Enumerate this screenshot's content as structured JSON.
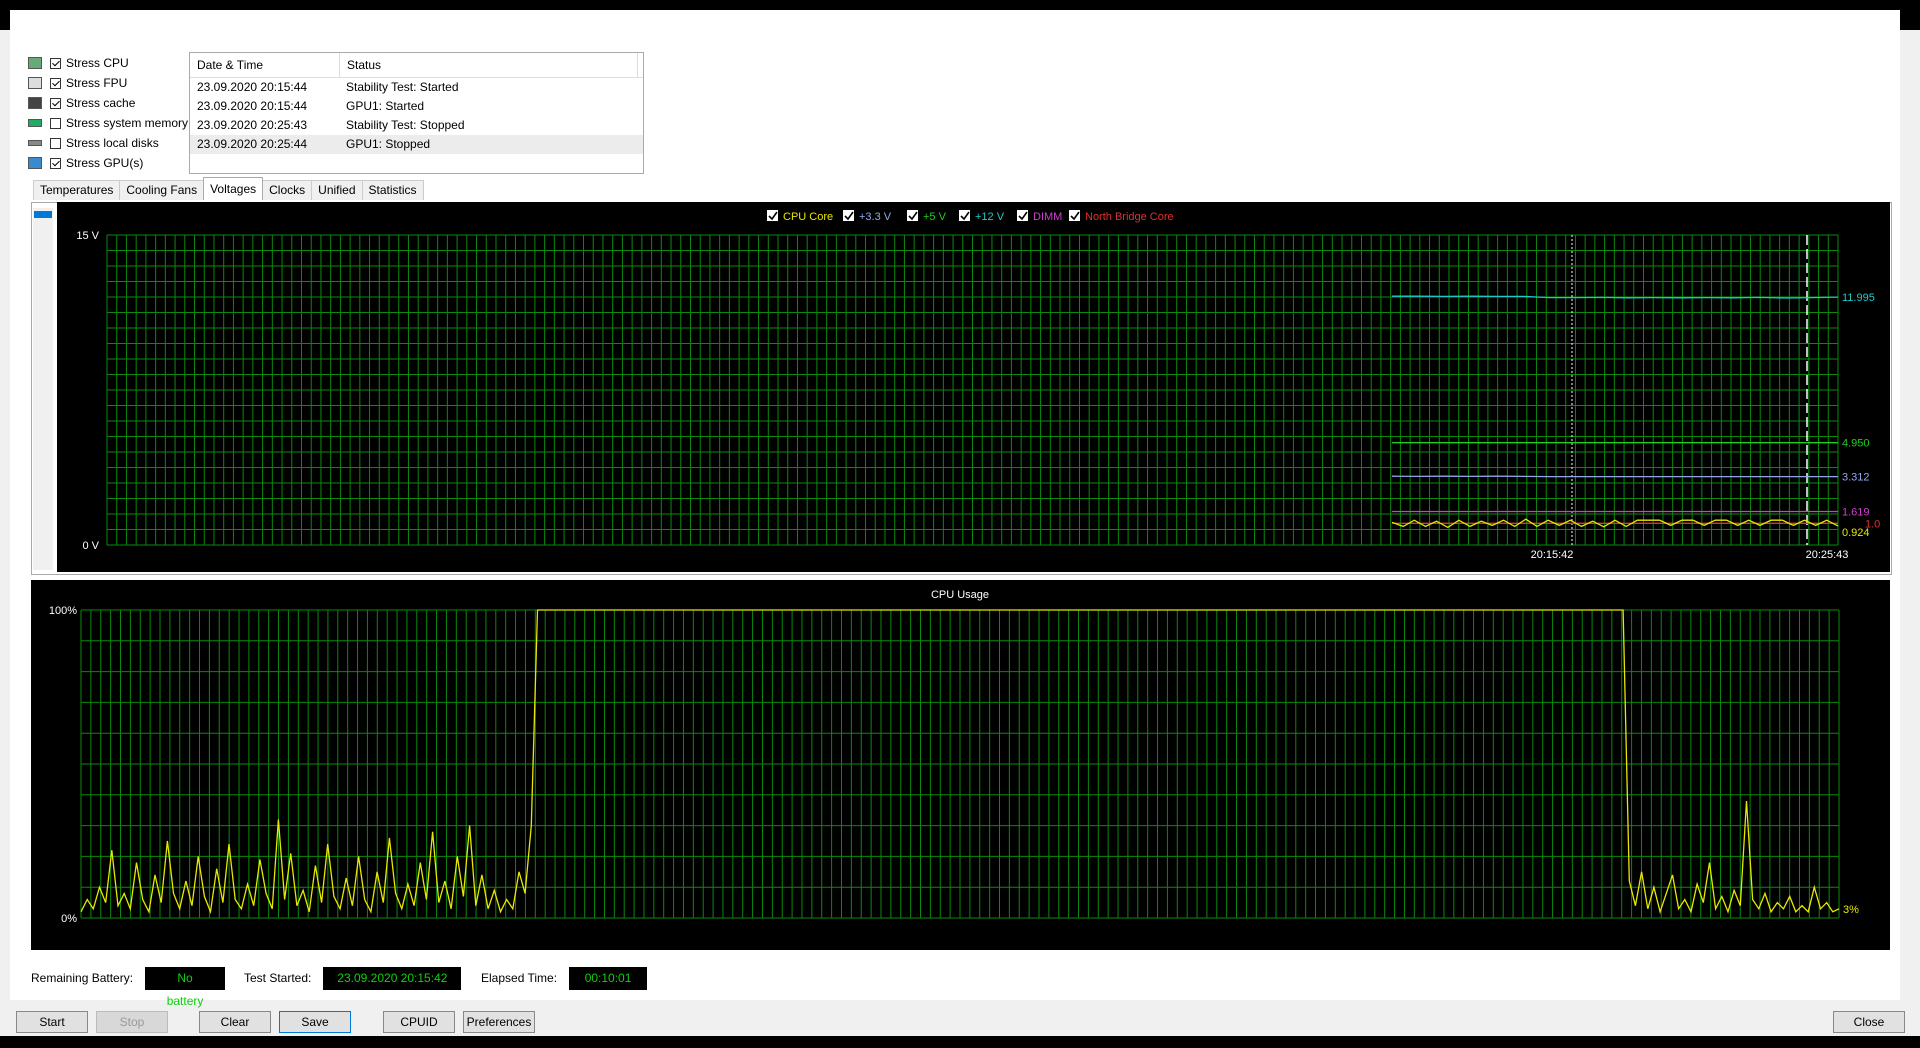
{
  "stress_options": [
    {
      "label": "Stress CPU",
      "checked": true,
      "icon": "cpu-icon"
    },
    {
      "label": "Stress FPU",
      "checked": true,
      "icon": "fpu-icon"
    },
    {
      "label": "Stress cache",
      "checked": true,
      "icon": "cache-icon"
    },
    {
      "label": "Stress system memory",
      "checked": false,
      "icon": "memory-icon"
    },
    {
      "label": "Stress local disks",
      "checked": false,
      "icon": "disk-icon"
    },
    {
      "label": "Stress GPU(s)",
      "checked": true,
      "icon": "gpu-icon"
    }
  ],
  "log": {
    "headers": [
      "Date & Time",
      "Status"
    ],
    "rows": [
      [
        "23.09.2020 20:15:44",
        "Stability Test: Started"
      ],
      [
        "23.09.2020 20:15:44",
        "GPU1: Started"
      ],
      [
        "23.09.2020 20:25:43",
        "Stability Test: Stopped"
      ],
      [
        "23.09.2020 20:25:44",
        "GPU1: Stopped"
      ]
    ]
  },
  "tabs": [
    "Temperatures",
    "Cooling Fans",
    "Voltages",
    "Clocks",
    "Unified",
    "Statistics"
  ],
  "active_tab": "Voltages",
  "colors": {
    "grid": "#0a8a0a",
    "cpu_core": "#e8e800",
    "v33": "#8fa9e8",
    "v5": "#1fd01f",
    "v12": "#20c8c8",
    "dimm": "#d040d0",
    "nb": "#e03030"
  },
  "chart_data": [
    {
      "type": "line",
      "title": "",
      "ylabel_top": "15 V",
      "ylabel_bottom": "0 V",
      "ylim": [
        0,
        15
      ],
      "x_ticks": [
        "20:15:42",
        "20:25:43"
      ],
      "legend": [
        {
          "name": "CPU Core",
          "checked": true
        },
        {
          "name": "+3.3 V",
          "checked": true
        },
        {
          "name": "+5 V",
          "checked": true
        },
        {
          "name": "+12 V",
          "checked": true
        },
        {
          "name": "DIMM",
          "checked": true
        },
        {
          "name": "North Bridge Core",
          "checked": true
        }
      ],
      "series": [
        {
          "name": "+12 V",
          "last_value": "11.995",
          "values": [
            12.04,
            12.04,
            12.03,
            12.04,
            12.03,
            12.03,
            11.97,
            11.97,
            11.98,
            11.96,
            11.97,
            11.96,
            11.97,
            11.96,
            11.98,
            11.95,
            11.97,
            11.995
          ]
        },
        {
          "name": "+5 V",
          "last_value": "4.950",
          "values": [
            4.95,
            4.95,
            4.95,
            4.95,
            4.95,
            4.95,
            4.95,
            4.95,
            4.95,
            4.95,
            4.95,
            4.95,
            4.95,
            4.95,
            4.95,
            4.95,
            4.95,
            4.95
          ]
        },
        {
          "name": "+3.3 V",
          "last_value": "3.312",
          "values": [
            3.33,
            3.32,
            3.33,
            3.32,
            3.33,
            3.32,
            3.31,
            3.31,
            3.31,
            3.31,
            3.31,
            3.31,
            3.31,
            3.31,
            3.31,
            3.31,
            3.31,
            3.312
          ]
        },
        {
          "name": "DIMM",
          "last_value": "1.619",
          "values": [
            1.62,
            1.62,
            1.62,
            1.62,
            1.62,
            1.62,
            1.62,
            1.62,
            1.62,
            1.62,
            1.62,
            1.62,
            1.62,
            1.62,
            1.62,
            1.62,
            1.62,
            1.619
          ]
        },
        {
          "name": "North Bridge Core",
          "last_value": "1.0",
          "values": [
            1.05,
            1.05,
            1.05,
            1.05,
            1.05,
            1.05,
            1.05,
            1.05,
            1.05,
            1.05,
            1.05,
            1.05,
            1.05,
            1.05,
            1.05,
            1.05,
            1.05,
            1.05
          ]
        },
        {
          "name": "CPU Core",
          "last_value": "0.924",
          "values": [
            1.1,
            0.9,
            1.2,
            0.9,
            1.15,
            0.85,
            1.2,
            0.9,
            1.15,
            0.95,
            1.2,
            0.9,
            1.25,
            0.9,
            1.2,
            0.95,
            1.2,
            0.9,
            1.15,
            0.88,
            1.2,
            0.9,
            1.2,
            1.2,
            1.2,
            0.95,
            1.2,
            1.2,
            0.95,
            1.2,
            1.2,
            0.95,
            1.2,
            0.95,
            1.2,
            1.2,
            0.95,
            1.2,
            0.95,
            1.2,
            0.924
          ]
        }
      ]
    },
    {
      "type": "line",
      "title": "CPU Usage",
      "ylabel_top": "100%",
      "ylabel_bottom": "0%",
      "ylim": [
        0,
        100
      ],
      "last_value": "3%",
      "series": [
        {
          "name": "CPU Usage",
          "values": [
            2,
            6,
            3,
            10,
            5,
            22,
            4,
            8,
            3,
            18,
            6,
            2,
            14,
            5,
            25,
            8,
            3,
            12,
            4,
            20,
            7,
            2,
            16,
            5,
            24,
            6,
            3,
            11,
            4,
            19,
            8,
            3,
            32,
            6,
            21,
            4,
            9,
            2,
            17,
            5,
            24,
            7,
            3,
            13,
            4,
            20,
            6,
            2,
            15,
            5,
            26,
            8,
            3,
            11,
            4,
            18,
            6,
            28,
            5,
            12,
            3,
            20,
            7,
            30,
            4,
            14,
            3,
            9,
            2,
            6,
            3,
            15,
            8,
            30,
            100,
            100,
            100,
            100,
            100,
            100,
            100,
            100,
            100,
            100,
            100,
            100,
            100,
            100,
            100,
            100,
            100,
            100,
            100,
            100,
            100,
            100,
            100,
            100,
            100,
            100,
            100,
            100,
            100,
            100,
            100,
            100,
            100,
            100,
            100,
            100,
            100,
            100,
            100,
            100,
            100,
            100,
            100,
            100,
            100,
            100,
            100,
            100,
            100,
            100,
            100,
            100,
            100,
            100,
            100,
            100,
            100,
            100,
            100,
            100,
            100,
            100,
            100,
            100,
            100,
            100,
            100,
            100,
            100,
            100,
            100,
            100,
            100,
            100,
            100,
            100,
            100,
            100,
            100,
            100,
            100,
            100,
            100,
            100,
            100,
            100,
            100,
            100,
            100,
            100,
            100,
            100,
            100,
            100,
            100,
            100,
            100,
            100,
            100,
            100,
            100,
            100,
            100,
            100,
            100,
            100,
            100,
            100,
            100,
            100,
            100,
            100,
            100,
            100,
            100,
            100,
            100,
            100,
            100,
            100,
            100,
            100,
            100,
            100,
            100,
            100,
            100,
            100,
            100,
            100,
            100,
            100,
            100,
            100,
            100,
            100,
            100,
            100,
            100,
            100,
            100,
            100,
            100,
            100,
            100,
            100,
            100,
            100,
            100,
            100,
            100,
            100,
            100,
            100,
            100,
            100,
            100,
            100,
            100,
            100,
            100,
            100,
            100,
            100,
            100,
            100,
            100,
            100,
            100,
            100,
            100,
            100,
            100,
            100,
            100,
            100,
            100,
            12,
            4,
            15,
            3,
            10,
            2,
            8,
            14,
            3,
            6,
            2,
            11,
            5,
            18,
            3,
            7,
            2,
            9,
            4,
            38,
            6,
            3,
            8,
            2,
            5,
            3,
            7,
            2,
            4,
            2,
            10,
            3,
            5,
            2,
            3
          ]
        }
      ]
    }
  ],
  "status": {
    "battery_label": "Remaining Battery:",
    "battery_value": "No battery",
    "test_started_label": "Test Started:",
    "test_started_value": "23.09.2020 20:15:42",
    "elapsed_label": "Elapsed Time:",
    "elapsed_value": "00:10:01"
  },
  "buttons": {
    "start": "Start",
    "stop": "Stop",
    "clear": "Clear",
    "save": "Save",
    "cpuid": "CPUID",
    "preferences": "Preferences",
    "close": "Close"
  }
}
